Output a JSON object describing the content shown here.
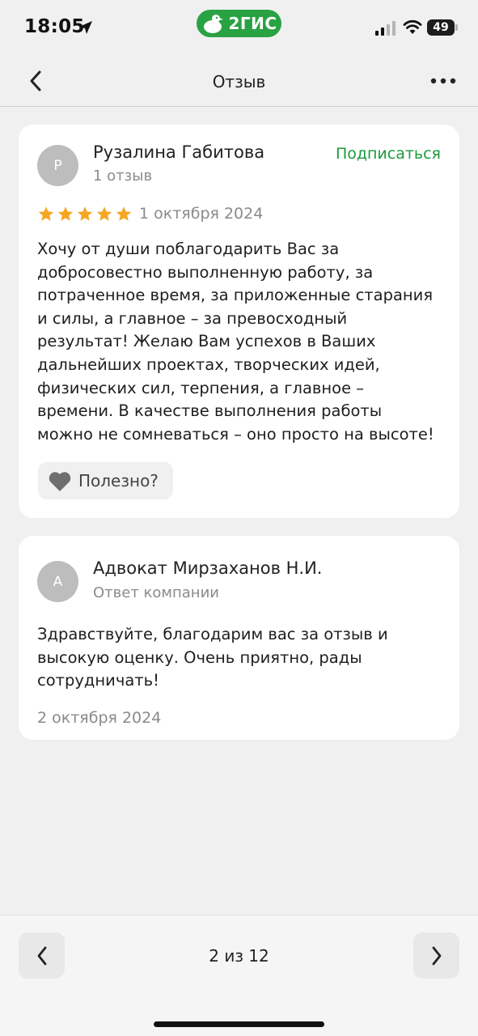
{
  "status_bar": {
    "time": "18:05",
    "brand": "2ГИС",
    "battery": "49",
    "icons": [
      "location-arrow-icon",
      "signal-icon",
      "wifi-icon",
      "battery-icon"
    ]
  },
  "nav": {
    "title": "Отзыв",
    "back_icon": "chevron-left-icon",
    "more_icon": "more-dots-icon"
  },
  "review": {
    "avatar_initial": "Р",
    "author": "Рузалина Габитова",
    "author_meta": "1 отзыв",
    "subscribe_label": "Подписаться",
    "rating": 5,
    "rating_max": 5,
    "date": "1 октября 2024",
    "text_lines": [
      "Хочу от души поблагодарить Вас за",
      "добросовестно выполненную работу, за",
      "потраченное время, за приложенные старания",
      "и силы, а главное – за превосходный",
      "результат! Желаю Вам успехов в Ваших",
      "дальнейших проектах, творческих идей,",
      "физических сил, терпения, а главное –",
      "времени. В качестве выполнения работы",
      "можно не сомневаться – оно просто на высоте!"
    ],
    "helpful_label": "Полезно?"
  },
  "reply": {
    "avatar_initial": "А",
    "author": "Адвокат Мирзаханов Н.И.",
    "author_meta": "Ответ компании",
    "text_lines": [
      "Здравствуйте, благодарим вас за отзыв и",
      "высокую оценку. Очень приятно, рады",
      "сотрудничать!"
    ],
    "date": "2 октября 2024"
  },
  "pager": {
    "label": "2 из 12",
    "prev_icon": "chevron-left-icon",
    "next_icon": "chevron-right-icon"
  },
  "colors": {
    "brand_green": "#29a243",
    "subscribe_green": "#1a9a3c",
    "star_yellow": "#f5a623",
    "avatar_gray": "#bdbdbd",
    "background": "#f0f0f0"
  }
}
